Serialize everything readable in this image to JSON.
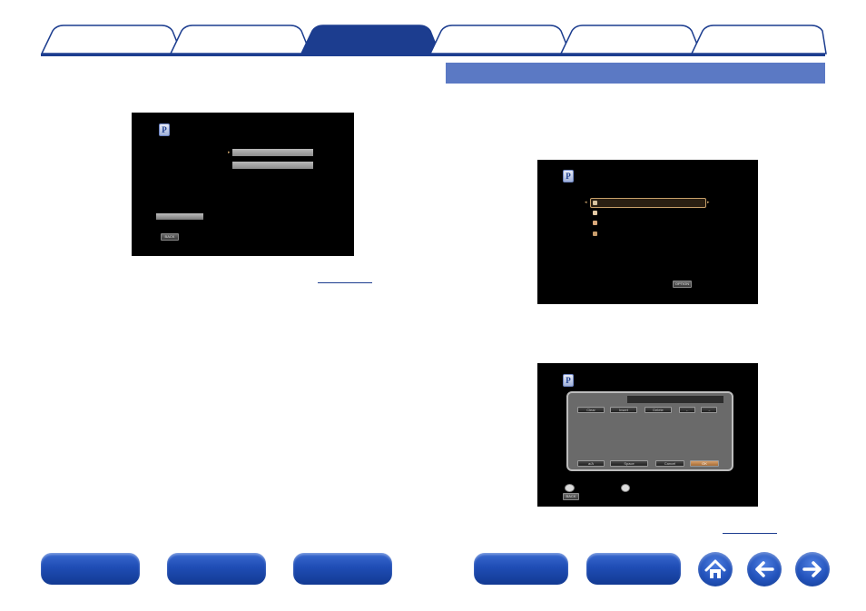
{
  "tabs": {
    "count": 6,
    "active_index": 2,
    "active_color": "#1c3d8f",
    "inactive_color": "#ffffff",
    "border_color": "#1c3d8f"
  },
  "section_header": {
    "color": "#5b79c4"
  },
  "screen1": {
    "logo_letter": "P",
    "back_label": "BACK"
  },
  "screen2": {
    "logo_letter": "P",
    "option_label": "OPTION"
  },
  "screen3": {
    "logo_letter": "P",
    "keys_row1": [
      "Clear",
      "Insert",
      "Delete",
      "←",
      "→"
    ],
    "keys_row2": [
      "a/A",
      "Space",
      "Cancel",
      "OK"
    ],
    "back_label": "BACK"
  },
  "bottom_nav": {
    "buttons": 5,
    "icons": [
      "home-icon",
      "back-arrow-icon",
      "forward-arrow-icon"
    ],
    "color": "#1f4db5"
  }
}
